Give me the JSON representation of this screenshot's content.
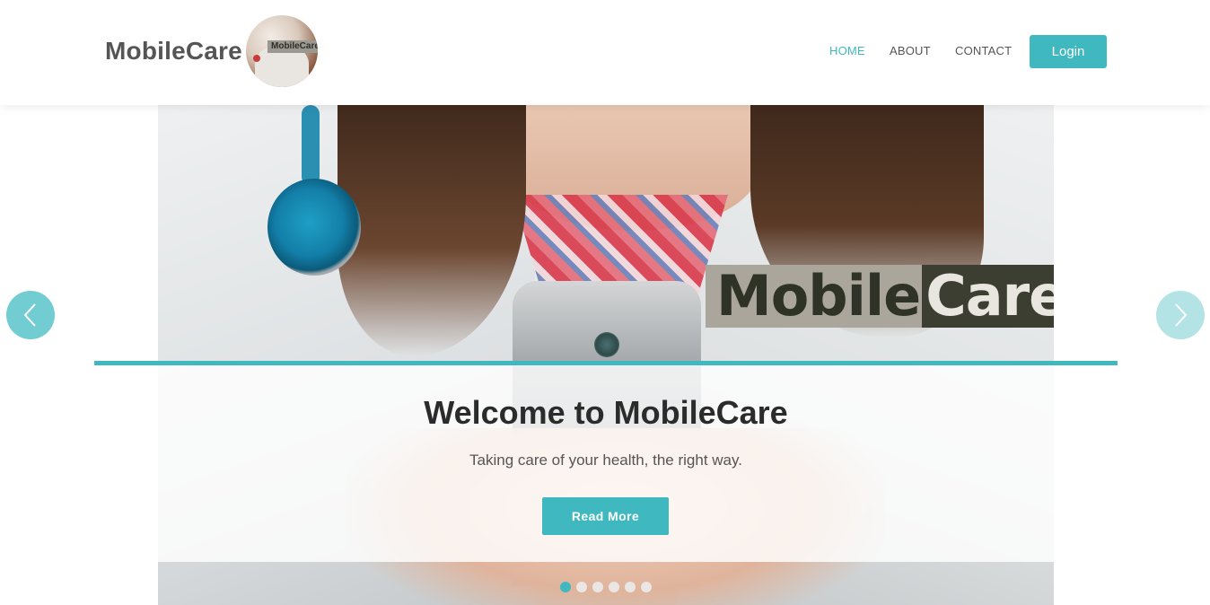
{
  "header": {
    "brand": "MobileCare",
    "logo_text": "MobileCare",
    "nav": [
      {
        "label": "HOME",
        "active": true
      },
      {
        "label": "ABOUT",
        "active": false
      },
      {
        "label": "CONTACT",
        "active": false
      }
    ],
    "login_label": "Login"
  },
  "hero": {
    "watermark_left": "Mobile",
    "watermark_right": "Care",
    "title": "Welcome to MobileCare",
    "subtitle": "Taking care of your health, the right way.",
    "cta_label": "Read More"
  },
  "carousel": {
    "slide_count": 6,
    "active_index": 0,
    "prev_icon": "chevron-left-icon",
    "next_icon": "chevron-right-icon"
  },
  "colors": {
    "accent": "#3fb8c0",
    "text_dark": "#2b2b2b",
    "text_muted": "#555555"
  }
}
